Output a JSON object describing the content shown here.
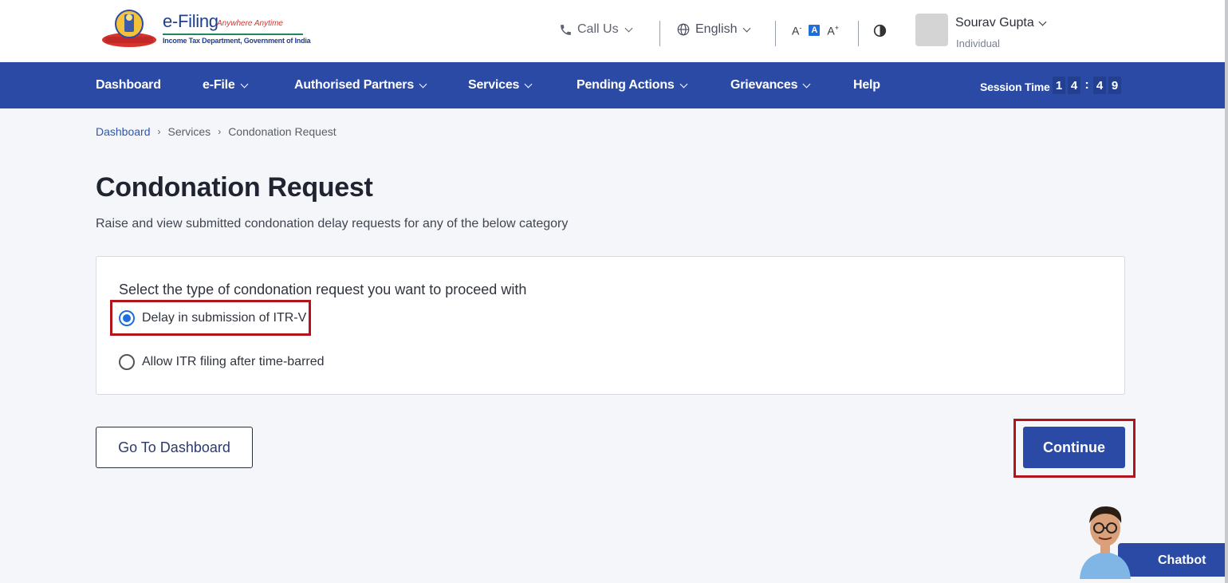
{
  "header": {
    "logo_title": "e-Filing",
    "logo_tagline": "Anywhere Anytime",
    "logo_subtitle": "Income Tax Department, Government of India",
    "call_us": "Call Us",
    "language": "English",
    "font_decrease": "A",
    "font_normal": "A",
    "font_increase": "A",
    "user_name": "Sourav Gupta",
    "user_role": "Individual"
  },
  "nav": {
    "items": [
      {
        "label": "Dashboard",
        "has_dropdown": false
      },
      {
        "label": "e-File",
        "has_dropdown": true
      },
      {
        "label": "Authorised Partners",
        "has_dropdown": true
      },
      {
        "label": "Services",
        "has_dropdown": true
      },
      {
        "label": "Pending Actions",
        "has_dropdown": true
      },
      {
        "label": "Grievances",
        "has_dropdown": true
      },
      {
        "label": "Help",
        "has_dropdown": false
      }
    ],
    "session_label": "Session Time",
    "session_digits": [
      "1",
      "4",
      "4",
      "9"
    ]
  },
  "breadcrumb": [
    "Dashboard",
    "Services",
    "Condonation Request"
  ],
  "page": {
    "title": "Condonation Request",
    "description": "Raise and view submitted condonation delay requests for any of the below category"
  },
  "form": {
    "question": "Select the type of condonation request you want to proceed with",
    "options": [
      {
        "label": "Delay in submission of ITR-V",
        "selected": true
      },
      {
        "label": "Allow ITR filing after time-barred",
        "selected": false
      }
    ]
  },
  "actions": {
    "go_to_dashboard": "Go To Dashboard",
    "continue": "Continue"
  },
  "chatbot": {
    "label": "Chatbot"
  },
  "colors": {
    "primary_blue": "#2a4aa6",
    "highlight_red": "#b3141c",
    "radio_blue": "#1e6fd9"
  }
}
